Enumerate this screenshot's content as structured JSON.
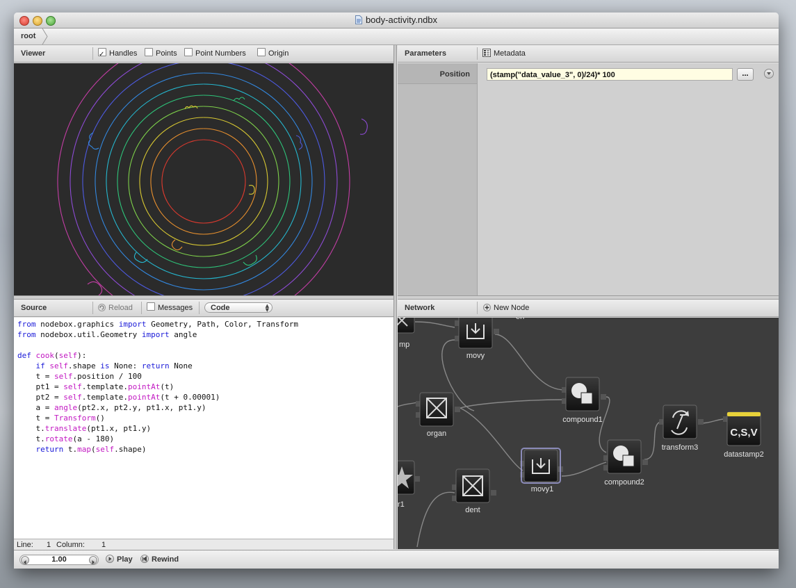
{
  "window": {
    "title": "body-activity.ndbx"
  },
  "breadcrumb": {
    "root": "root"
  },
  "viewer": {
    "title": "Viewer",
    "options": [
      {
        "label": "Handles",
        "checked": true
      },
      {
        "label": "Points",
        "checked": false
      },
      {
        "label": "Point Numbers",
        "checked": false
      },
      {
        "label": "Origin",
        "checked": false
      }
    ]
  },
  "parameters": {
    "title": "Parameters",
    "metadata_label": "Metadata",
    "rows": [
      {
        "label": "Position",
        "value": "(stamp(\"data_value_3\", 0)/24)* 100",
        "button": "..."
      }
    ]
  },
  "source": {
    "title": "Source",
    "reload_label": "Reload",
    "messages_label": "Messages",
    "mode_label": "Code",
    "code_lines": [
      "from nodebox.graphics import Geometry, Path, Color, Transform",
      "from nodebox.util.Geometry import angle",
      "",
      "def cook(self):",
      "    if self.shape is None: return None",
      "    t = self.position / 100",
      "    pt1 = self.template.pointAt(t)",
      "    pt2 = self.template.pointAt(t + 0.00001)",
      "    a = angle(pt2.x, pt2.y, pt1.x, pt1.y)",
      "    t = Transform()",
      "    t.translate(pt1.x, pt1.y)",
      "    t.rotate(a - 180)",
      "    return t.map(self.shape)"
    ],
    "status": {
      "line_label": "Line:",
      "line_value": "1",
      "column_label": "Column:",
      "column_value": "1"
    }
  },
  "network": {
    "title": "Network",
    "new_node_label": "New Node",
    "nodes": [
      {
        "label": "mp",
        "icon": "stamp-partial-icon"
      },
      {
        "label": "movy",
        "icon": "move-icon"
      },
      {
        "label": "organ",
        "icon": "rect-cross-icon"
      },
      {
        "label": "compound1",
        "icon": "compound-icon"
      },
      {
        "label": "r1",
        "icon": "star-icon"
      },
      {
        "label": "dent",
        "icon": "rect-cross-icon"
      },
      {
        "label": "movy1",
        "icon": "move-icon"
      },
      {
        "label": "compound2",
        "icon": "compound-icon"
      },
      {
        "label": "transform3",
        "icon": "transform-icon"
      },
      {
        "label": "datastamp2",
        "icon": "datastamp-icon",
        "glyph": "C,S,V"
      }
    ]
  },
  "playback": {
    "frame": "1.00",
    "play_label": "Play",
    "rewind_label": "Rewind"
  },
  "colors": {
    "viewer_bg": "#2b2b2b",
    "network_bg": "#3d3d3d",
    "param_value_bg": "#fffde3"
  }
}
